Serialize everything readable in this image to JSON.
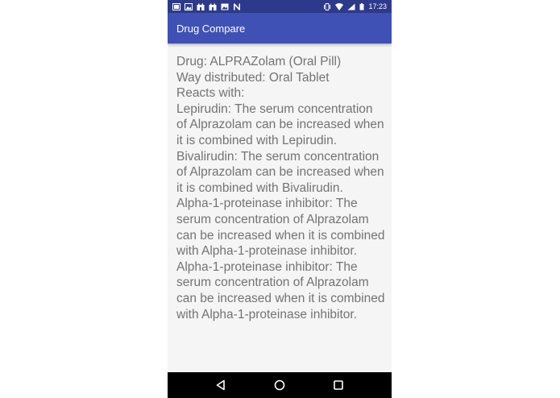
{
  "status_bar": {
    "time": "17:23",
    "notification_icons": [
      "photo-icon",
      "image-icon",
      "castle-icon",
      "castle-icon",
      "image-icon",
      "n-icon"
    ],
    "system_icons": [
      "vibrate-icon",
      "wifi-icon",
      "signal-icon",
      "battery-icon"
    ]
  },
  "app_bar": {
    "title": "Drug Compare"
  },
  "content": {
    "drug_info": "Drug: ALPRAZolam (Oral Pill)\nWay distributed: Oral Tablet\nReacts with:\nLepirudin: The serum concentration of Alprazolam can be increased when it is combined with Lepirudin.\nBivalirudin: The serum concentration of Alprazolam can be increased when it is combined with Bivalirudin.\nAlpha-1-proteinase inhibitor: The serum concentration of Alprazolam can be increased when it is combined with Alpha-1-proteinase inhibitor.\nAlpha-1-proteinase inhibitor: The serum concentration of Alprazolam can be increased when it is combined with Alpha-1-proteinase inhibitor."
  },
  "nav_bar": {
    "buttons": [
      "back-icon",
      "home-icon",
      "recents-icon"
    ]
  },
  "colors": {
    "status_bar": "#2d3a8c",
    "app_bar": "#3f51b5",
    "content_bg": "#f5f5f5",
    "text": "#737373",
    "nav_bar": "#000000"
  }
}
